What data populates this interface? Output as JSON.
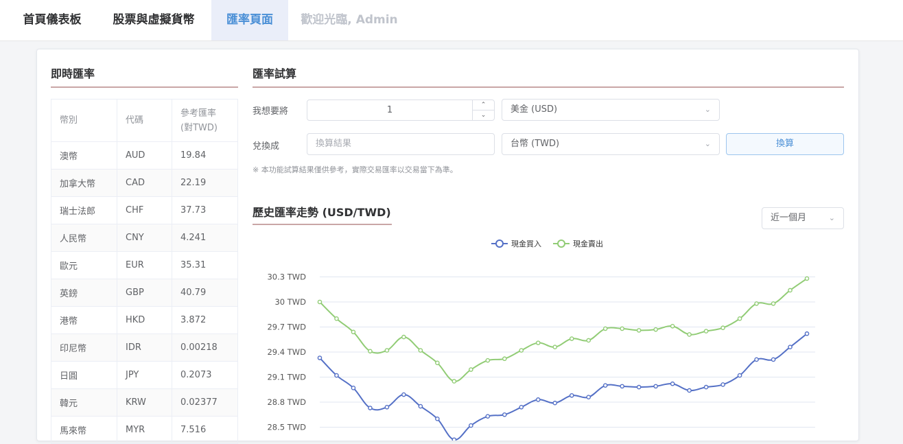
{
  "nav": {
    "tabs": [
      {
        "label": "首頁儀表板"
      },
      {
        "label": "股票與虛擬貨幣"
      },
      {
        "label": "匯率頁面"
      },
      {
        "label": "歡迎光臨, Admin"
      }
    ]
  },
  "realtime": {
    "title": "即時匯率",
    "headers": {
      "currency": "幣別",
      "code": "代碼",
      "rate_line1": "參考匯率",
      "rate_line2": "(對TWD)"
    },
    "rows": [
      {
        "name": "澳幣",
        "code": "AUD",
        "rate": "19.84"
      },
      {
        "name": "加拿大幣",
        "code": "CAD",
        "rate": "22.19"
      },
      {
        "name": "瑞士法郎",
        "code": "CHF",
        "rate": "37.73"
      },
      {
        "name": "人民幣",
        "code": "CNY",
        "rate": "4.241"
      },
      {
        "name": "歐元",
        "code": "EUR",
        "rate": "35.31"
      },
      {
        "name": "英鎊",
        "code": "GBP",
        "rate": "40.79"
      },
      {
        "name": "港幣",
        "code": "HKD",
        "rate": "3.872"
      },
      {
        "name": "印尼幣",
        "code": "IDR",
        "rate": "0.00218"
      },
      {
        "name": "日圓",
        "code": "JPY",
        "rate": "0.2073"
      },
      {
        "name": "韓元",
        "code": "KRW",
        "rate": "0.02377"
      },
      {
        "name": "馬來幣",
        "code": "MYR",
        "rate": "7.516"
      }
    ]
  },
  "converter": {
    "title": "匯率試算",
    "from_label": "我想要將",
    "amount": "1",
    "from_currency": "美金 (USD)",
    "to_label": "兌換成",
    "result_placeholder": "換算結果",
    "to_currency": "台幣 (TWD)",
    "convert_button": "換算",
    "note": "※ 本功能試算結果僅供參考，實際交易匯率以交易當下為準。"
  },
  "history": {
    "title": "歷史匯率走勢 (USD/TWD)",
    "period": "近一個月"
  },
  "colors": {
    "buy": "#5470c6",
    "sell": "#91cc75",
    "accent": "#4a8fd6"
  },
  "icons": {
    "chevron": "chevron-down-icon",
    "stepper_up": "chevron-up-icon",
    "stepper_down": "chevron-down-icon"
  },
  "chart_data": {
    "type": "line",
    "title": "",
    "xlabel": "",
    "ylabel": "",
    "y_ticks": [
      "30.3 TWD",
      "30 TWD",
      "29.7 TWD",
      "29.4 TWD",
      "29.1 TWD",
      "28.8 TWD",
      "28.5 TWD"
    ],
    "y_tick_values": [
      30.3,
      30.0,
      29.7,
      29.4,
      29.1,
      28.8,
      28.5
    ],
    "legend_position": "top-center",
    "series": [
      {
        "name": "現金買入",
        "color": "#5470c6",
        "values": [
          29.33,
          29.12,
          28.97,
          28.73,
          28.74,
          28.89,
          28.75,
          28.6,
          28.35,
          28.52,
          28.63,
          28.65,
          28.74,
          28.83,
          28.79,
          28.88,
          28.86,
          29.0,
          28.99,
          28.98,
          28.99,
          29.02,
          28.94,
          28.98,
          29.01,
          29.12,
          29.31,
          29.31,
          29.46,
          29.62
        ]
      },
      {
        "name": "現金賣出",
        "color": "#91cc75",
        "values": [
          30.0,
          29.8,
          29.64,
          29.41,
          29.42,
          29.58,
          29.42,
          29.27,
          29.05,
          29.19,
          29.3,
          29.32,
          29.42,
          29.51,
          29.46,
          29.56,
          29.54,
          29.68,
          29.68,
          29.66,
          29.67,
          29.71,
          29.61,
          29.65,
          29.69,
          29.8,
          29.98,
          29.98,
          30.14,
          30.28
        ]
      }
    ]
  }
}
